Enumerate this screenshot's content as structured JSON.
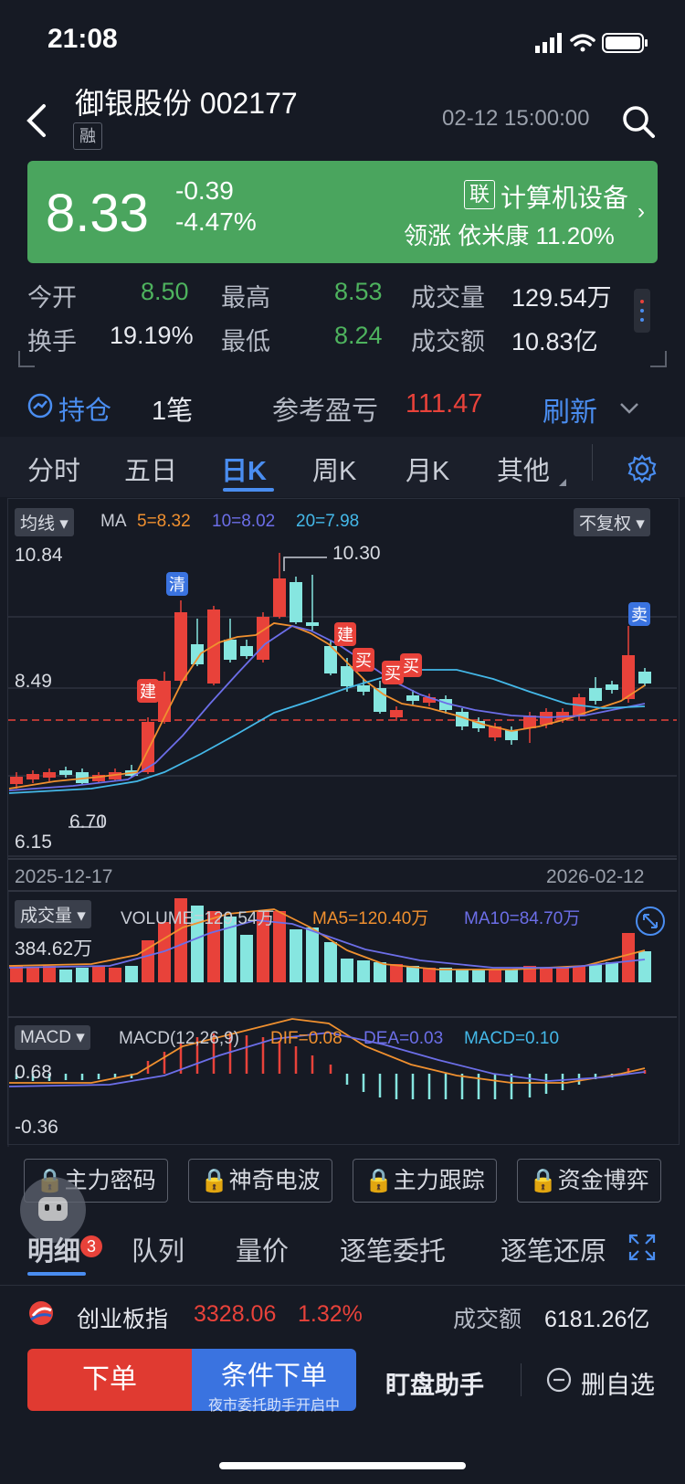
{
  "status": {
    "time": "21:08"
  },
  "stock": {
    "name_code": "御银股份 002177",
    "margin_tag": "融",
    "datetime": "02-12 15:00:00",
    "price": "8.33",
    "change": "-0.39",
    "change_pct": "-4.47%",
    "sector_tag": "联",
    "sector": "计算机设备",
    "lead_label": "领涨",
    "lead_stock": "依米康 11.20%"
  },
  "quote": {
    "open_label": "今开",
    "open": "8.50",
    "high_label": "最高",
    "high": "8.53",
    "vol_label": "成交量",
    "vol": "129.54万",
    "turnover_label": "换手",
    "turnover": "19.19%",
    "low_label": "最低",
    "low": "8.24",
    "amount_label": "成交额",
    "amount": "10.83亿"
  },
  "position": {
    "label": "持仓",
    "count": "1笔",
    "pnl_label": "参考盈亏",
    "pnl": "111.47",
    "refresh": "刷新"
  },
  "tabs": [
    "分时",
    "五日",
    "日K",
    "周K",
    "月K",
    "其他"
  ],
  "kline": {
    "ma_dropdown": "均线",
    "ma_label": "MA",
    "ma5": "5=8.32",
    "ma10": "10=8.02",
    "ma20": "20=7.98",
    "adjust": "不复权",
    "y_top": "10.84",
    "y_mid": "8.49",
    "y_bottom": "6.15",
    "high_mark": "10.30",
    "low_mark": "6.70",
    "date_start": "2025-12-17",
    "date_end": "2026-02-12",
    "markers": [
      "清",
      "建",
      "建",
      "买",
      "买",
      "买",
      "卖"
    ]
  },
  "volume": {
    "dropdown": "成交量",
    "volume": "VOLUME=129.54万",
    "ma5": "MA5=120.40万",
    "ma10": "MA10=84.70万",
    "y_top": "384.62万"
  },
  "macd": {
    "dropdown": "MACD",
    "params": "MACD(12,26,9)",
    "dif": "DIF=0.08",
    "dea": "DEA=0.03",
    "macd": "MACD=0.10",
    "y_top": "0.68",
    "y_bottom": "-0.36"
  },
  "tools": [
    "主力密码",
    "神奇电波",
    "主力跟踪",
    "资金博弈"
  ],
  "subtabs": [
    "明细",
    "队列",
    "量价",
    "逐笔委托",
    "逐笔还原"
  ],
  "subtab_badge": "3",
  "index": {
    "name": "创业板指",
    "value": "3328.06",
    "pct": "1.32%",
    "amount_label": "成交额",
    "amount": "6181.26亿"
  },
  "bottom": {
    "order": "下单",
    "cond_order": "条件下单",
    "cond_sub": "夜市委托助手开启中",
    "helper": "盯盘助手",
    "remove": "删自选"
  },
  "colors": {
    "up": "#E8423A",
    "down": "#86E6E0",
    "accent": "#4A8DF0",
    "card": "#4AA55E"
  }
}
